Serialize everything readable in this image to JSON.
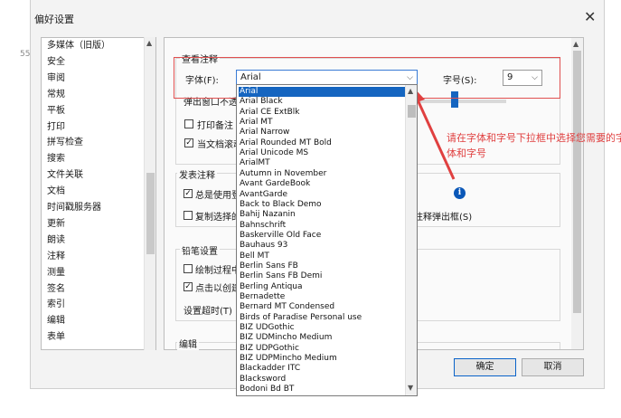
{
  "window": {
    "title": "偏好设置",
    "close_glyph": "✕",
    "background_fragment": "555"
  },
  "categories": [
    "多媒体（旧版）",
    "安全",
    "审阅",
    "常规",
    "平板",
    "打印",
    "拼写检查",
    "搜索",
    "文件关联",
    "文档",
    "时间戳服务器",
    "更新",
    "朗读",
    "注释",
    "测量",
    "签名",
    "索引",
    "编辑",
    "表单",
    "..."
  ],
  "panel": {
    "view_group": {
      "title": "查看注释",
      "font_label": "字体(F):",
      "font_value": "Arial",
      "size_label": "字号(S):",
      "size_value": "9",
      "popup_label": "弹出窗口不透",
      "print_label": "打印备注",
      "scroll_label": "当文档滚动"
    },
    "publish_group": {
      "title": "发表注释",
      "always_use_label": "总是使用登",
      "copy_label": "复制选择的",
      "popup_text_label": "注释弹出框(S)"
    },
    "pencil_group": {
      "title": "铅笔设置",
      "draw_label": "绘制过程中",
      "click_label": "点击以创建",
      "timeout_label": "设置超时(T)"
    },
    "edit_group": {
      "title": "编辑"
    }
  },
  "font_dropdown": [
    "Arial",
    "Arial Black",
    "Arial CE ExtBlk",
    "Arial MT",
    "Arial Narrow",
    "Arial Rounded MT Bold",
    "Arial Unicode MS",
    "ArialMT",
    "Autumn in November",
    "Avant GardeBook",
    "AvantGarde",
    "Back to Black Demo",
    "Bahij Nazanin",
    "Bahnschrift",
    "Baskerville Old Face",
    "Bauhaus 93",
    "Bell MT",
    "Berlin Sans FB",
    "Berlin Sans FB Demi",
    "Berling Antiqua",
    "Bernadette",
    "Bernard MT Condensed",
    "Birds of Paradise  Personal use",
    "BIZ UDGothic",
    "BIZ UDMincho Medium",
    "BIZ UDPGothic",
    "BIZ UDPMincho Medium",
    "Blackadder ITC",
    "Blacksword",
    "Bodoni Bd BT"
  ],
  "annotation": {
    "text": "请在字体和字号下拉框中选择您需要的字体和字号",
    "color": "#e04040"
  },
  "buttons": {
    "ok": "确定",
    "cancel": "取消"
  },
  "colors": {
    "selection": "#1565c0",
    "accent_border": "#3a7bd5"
  }
}
